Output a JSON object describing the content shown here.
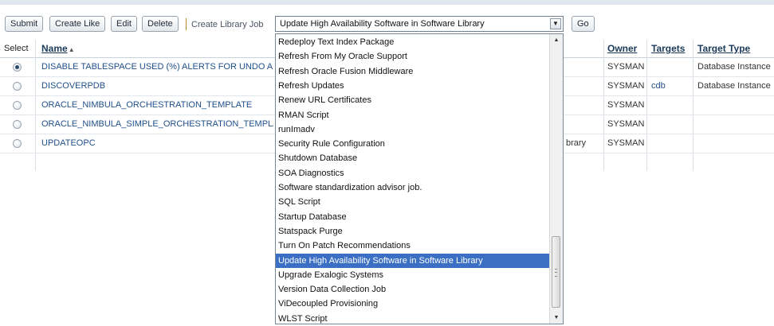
{
  "toolbar": {
    "submit": "Submit",
    "create_like": "Create Like",
    "edit": "Edit",
    "delete": "Delete",
    "create_library_job": "Create Library Job",
    "job_select_value": "Update High Availability Software in Software Library",
    "go": "Go"
  },
  "table": {
    "headers": {
      "select": "Select",
      "name": "Name",
      "owner": "Owner",
      "targets": "Targets",
      "target_type": "Target Type"
    },
    "rows": [
      {
        "selected": true,
        "name": "DISABLE TABLESPACE USED (%) ALERTS FOR UNDO AND TE",
        "type_fragment": "",
        "owner": "SYSMAN",
        "targets": "",
        "target_type": "Database Instance"
      },
      {
        "selected": false,
        "name": "DISCOVERPDB",
        "type_fragment": "",
        "owner": "SYSMAN",
        "targets": "cdb",
        "target_type": "Database Instance"
      },
      {
        "selected": false,
        "name": "ORACLE_NIMBULA_ORCHESTRATION_TEMPLATE",
        "type_fragment": "",
        "owner": "SYSMAN",
        "targets": "",
        "target_type": ""
      },
      {
        "selected": false,
        "name": "ORACLE_NIMBULA_SIMPLE_ORCHESTRATION_TEMPLATE",
        "type_fragment": "",
        "owner": "SYSMAN",
        "targets": "",
        "target_type": ""
      },
      {
        "selected": false,
        "name": "UPDATEOPC",
        "type_fragment": "brary",
        "owner": "SYSMAN",
        "targets": "",
        "target_type": ""
      }
    ]
  },
  "dropdown": {
    "options": [
      "Redeploy Text Index Package",
      "Refresh From My Oracle Support",
      "Refresh Oracle Fusion Middleware",
      "Refresh Updates",
      "Renew URL Certificates",
      "RMAN Script",
      "runImadv",
      "Security Rule Configuration",
      "Shutdown Database",
      "SOA Diagnostics",
      "Software standardization advisor job.",
      "SQL Script",
      "Startup Database",
      "Statspack Purge",
      "Turn On Patch Recommendations",
      "Update High Availability Software in Software Library",
      "Upgrade Exalogic Systems",
      "Version Data Collection Job",
      "ViDecoupled Provisioning",
      "WLST Script"
    ],
    "selected_index": 15
  },
  "colors": {
    "link": "#1f4f8b",
    "selection": "#3a6fc4",
    "header_text": "#1b3a5a"
  },
  "icons": {
    "sort": "sort-ascending-icon",
    "dropdown_arrow": "chevron-down-icon",
    "scroll_up": "scroll-up-arrow-icon",
    "scroll_down": "scroll-down-arrow-icon"
  }
}
